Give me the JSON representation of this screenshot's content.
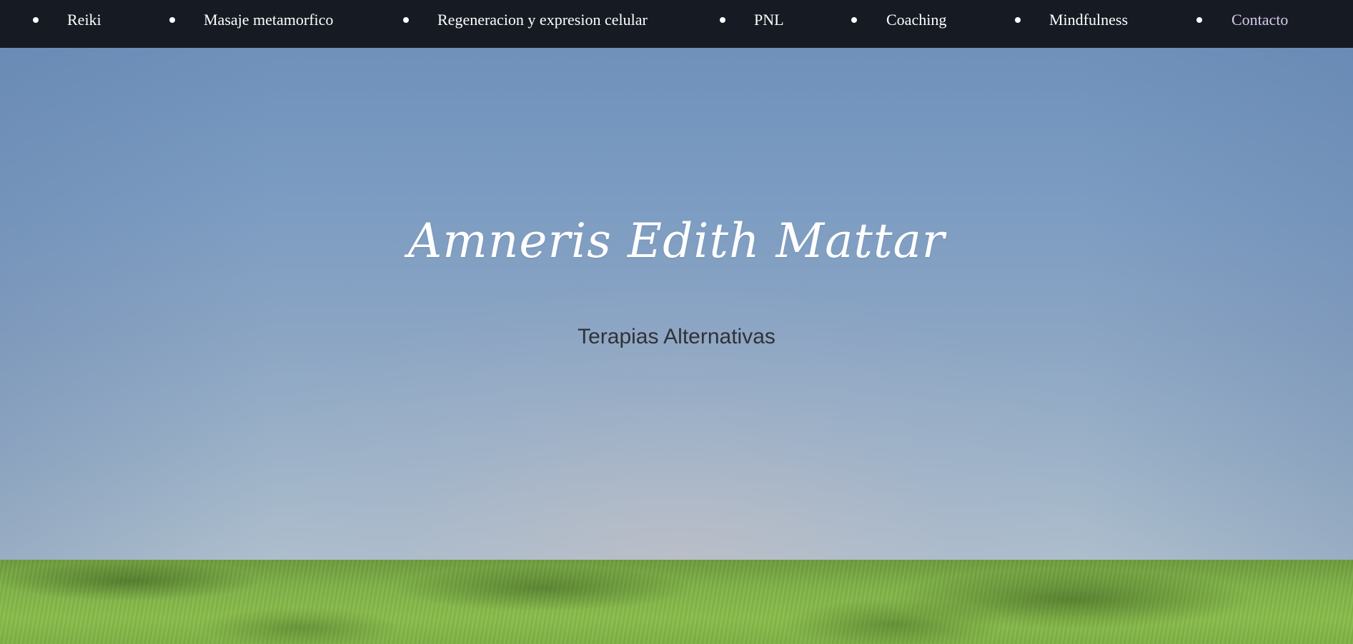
{
  "nav": {
    "items": [
      {
        "label": "Reiki"
      },
      {
        "label": "Masaje metamorfico"
      },
      {
        "label": "Regeneracion y expresion celular"
      },
      {
        "label": "PNL"
      },
      {
        "label": "Coaching"
      },
      {
        "label": "Mindfulness"
      },
      {
        "label": "Contacto"
      }
    ]
  },
  "hero": {
    "title": "Amneris Edith Mattar",
    "subtitle": "Terapias Alternativas"
  },
  "colors": {
    "navbar_bg": "#161b23",
    "nav_text": "#ffffff",
    "nav_visited": "#d9c8ee",
    "hero_title": "#ffffff",
    "hero_subtitle": "#2f3237"
  }
}
